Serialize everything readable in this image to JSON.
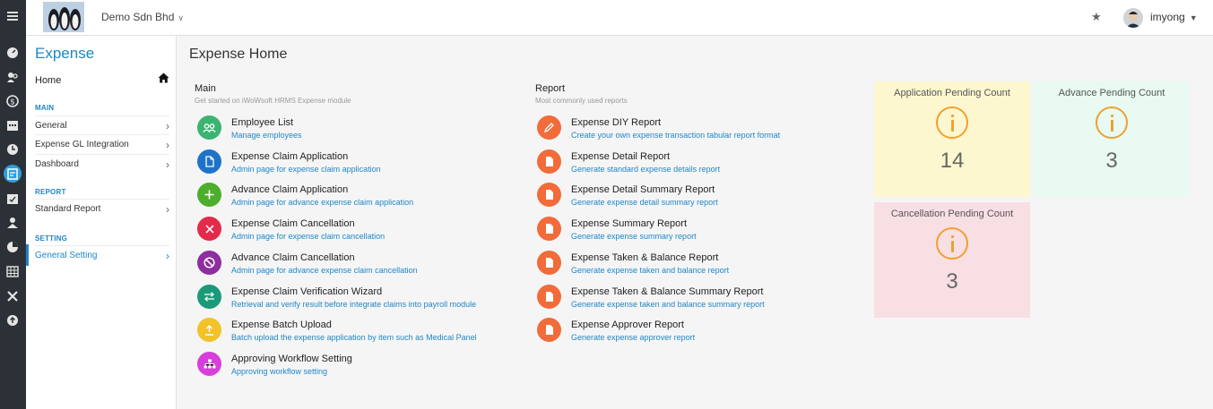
{
  "topbar": {
    "company": "Demo Sdn Bhd",
    "username": "imyong"
  },
  "leftmenu": {
    "title": "Expense",
    "home": "Home",
    "sections": [
      {
        "label": "MAIN",
        "items": [
          "General",
          "Expense GL Integration",
          "Dashboard"
        ]
      },
      {
        "label": "REPORT",
        "items": [
          "Standard Report"
        ]
      },
      {
        "label": "SETTING",
        "items": [
          "General Setting"
        ]
      }
    ]
  },
  "main": {
    "title": "Expense Home",
    "main_col": {
      "heading": "Main",
      "subtitle": "Get started on iWoWsoft HRMS Expense module",
      "items": [
        {
          "title": "Employee List",
          "subtitle": "Manage employees",
          "icon": "users-icon",
          "color": "#3cb371"
        },
        {
          "title": "Expense Claim Application",
          "subtitle": "Admin page for expense claim application",
          "icon": "document-icon",
          "color": "#1e73c8"
        },
        {
          "title": "Advance Claim Application",
          "subtitle": "Admin page for advance expense claim application",
          "icon": "plus-icon",
          "color": "#4cae2c"
        },
        {
          "title": "Expense Claim Cancellation",
          "subtitle": "Admin page for expense claim cancellation",
          "icon": "x-icon",
          "color": "#e32a4a"
        },
        {
          "title": "Advance Claim Cancellation",
          "subtitle": "Admin page for advance expense claim cancellation",
          "icon": "ban-icon",
          "color": "#8e2ea0"
        },
        {
          "title": "Expense Claim Verification Wizard",
          "subtitle": "Retrieval and verify result before integrate claims into payroll module",
          "icon": "swap-icon",
          "color": "#1a9a78"
        },
        {
          "title": "Expense Batch Upload",
          "subtitle": "Batch upload the expense application by item such as Medical Panel",
          "icon": "upload-icon",
          "color": "#f2c22a"
        },
        {
          "title": "Approving Workflow Setting",
          "subtitle": "Approving workflow setting",
          "icon": "sitemap-icon",
          "color": "#d63fd9"
        }
      ]
    },
    "report_col": {
      "heading": "Report",
      "subtitle": "Most commonly used reports",
      "items": [
        {
          "title": "Expense DIY Report",
          "subtitle": "Create your own expense transaction tabular report format",
          "icon": "pencil-icon",
          "color": "#f26b3a"
        },
        {
          "title": "Expense Detail Report",
          "subtitle": "Generate standard expense details report",
          "icon": "document-icon",
          "color": "#f26b3a"
        },
        {
          "title": "Expense Detail Summary Report",
          "subtitle": "Generate expense detail summary report",
          "icon": "document-icon",
          "color": "#f26b3a"
        },
        {
          "title": "Expense Summary Report",
          "subtitle": "Generate expense summary report",
          "icon": "document-icon",
          "color": "#f26b3a"
        },
        {
          "title": "Expense Taken & Balance Report",
          "subtitle": "Generate expense taken and balance report",
          "icon": "document-icon",
          "color": "#f26b3a"
        },
        {
          "title": "Expense Taken & Balance Summary Report",
          "subtitle": "Generate expense taken and balance summary report",
          "icon": "document-icon",
          "color": "#f26b3a"
        },
        {
          "title": "Expense Approver Report",
          "subtitle": "Generate expense approver report",
          "icon": "document-icon",
          "color": "#f26b3a"
        }
      ]
    },
    "cards": [
      {
        "title": "Application Pending Count",
        "value": "14",
        "bg": "#fdf7cf"
      },
      {
        "title": "Advance Pending Count",
        "value": "3",
        "bg": "#e8faf1"
      },
      {
        "title": "Cancellation Pending Count",
        "value": "3",
        "bg": "#f8dfe3"
      }
    ]
  }
}
